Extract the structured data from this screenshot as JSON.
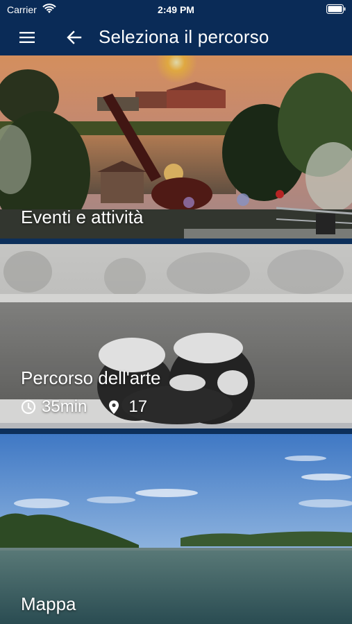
{
  "status_bar": {
    "carrier": "Carrier",
    "time": "2:49 PM",
    "icons": [
      "wifi-icon",
      "battery-icon"
    ]
  },
  "nav": {
    "title": "Seleziona il percorso",
    "icons": [
      "menu-icon",
      "back-arrow-icon"
    ]
  },
  "routes": [
    {
      "title": "Eventi e attività"
    },
    {
      "title": "Percorso dell'arte",
      "duration": "35min",
      "stops": "17",
      "icons": [
        "clock-icon",
        "location-pin-icon"
      ]
    },
    {
      "title": "Mappa"
    }
  ],
  "colors": {
    "bar": "#0a2b57",
    "separator": "#4a5a6e"
  }
}
